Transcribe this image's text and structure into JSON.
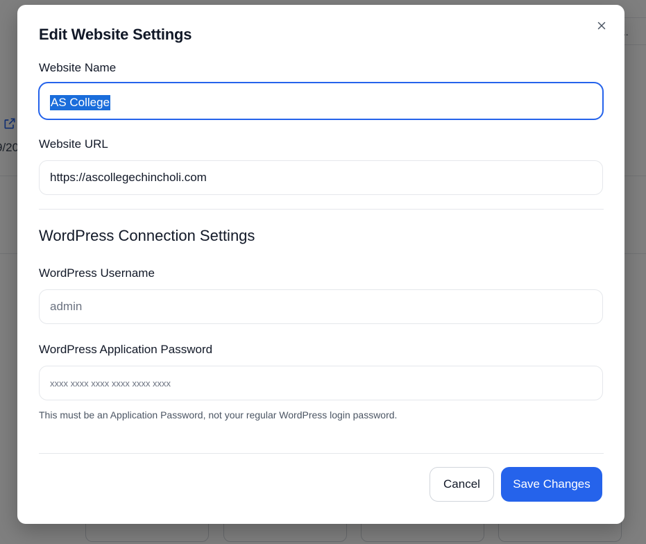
{
  "background": {
    "topbar_fragment": "s...",
    "date_fragment": "9/20"
  },
  "modal": {
    "title": "Edit Website Settings",
    "close_icon": "close-icon",
    "fields": {
      "website_name": {
        "label": "Website Name",
        "value": "AS College"
      },
      "website_url": {
        "label": "Website URL",
        "value": "https://ascollegechincholi.com"
      },
      "wp_username": {
        "label": "WordPress Username",
        "placeholder": "admin"
      },
      "wp_app_password": {
        "label": "WordPress Application Password",
        "placeholder": "xxxx xxxx xxxx xxxx xxxx xxxx",
        "hint": "This must be an Application Password, not your regular WordPress login password."
      }
    },
    "section_title": "WordPress Connection Settings",
    "buttons": {
      "cancel": "Cancel",
      "save": "Save Changes"
    }
  },
  "colors": {
    "primary": "#2563eb",
    "overlay": "rgba(0,0,0,0.5)",
    "selection": "#1a6ddb"
  }
}
